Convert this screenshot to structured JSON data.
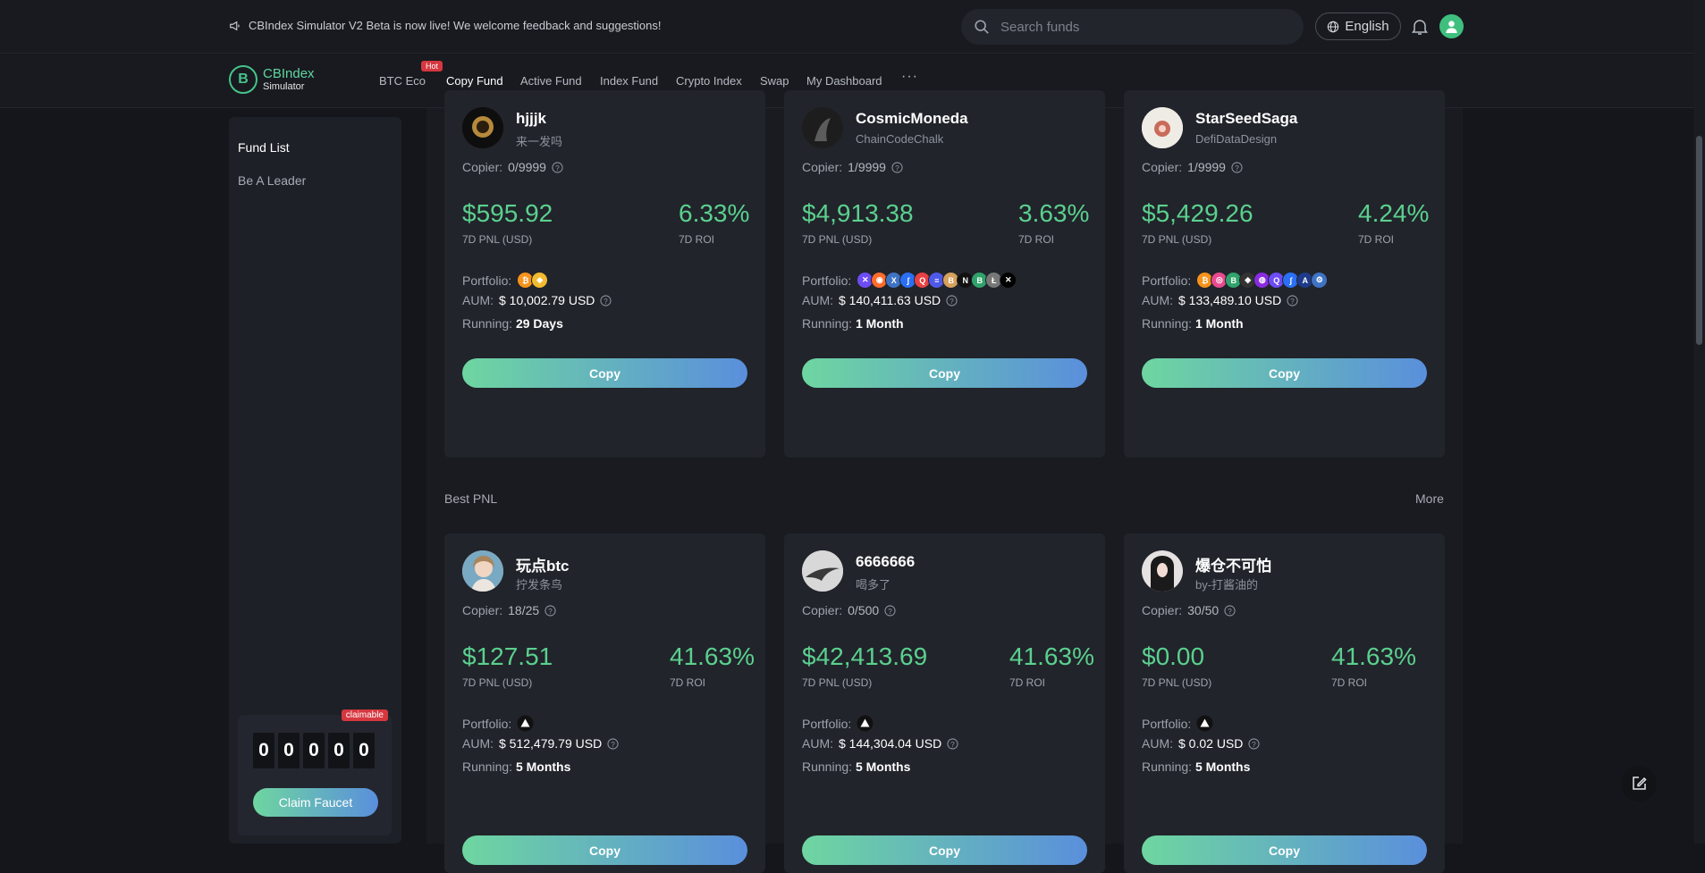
{
  "topbar": {
    "announcement": "CBIndex Simulator V2 Beta is now live! We welcome feedback and suggestions!",
    "search_placeholder": "Search funds",
    "language": "English"
  },
  "nav": {
    "logo_name": "CBIndex",
    "logo_sub": "Simulator",
    "logo_mark": "B",
    "hot_badge": "Hot",
    "items": [
      "BTC Eco",
      "Copy Fund",
      "Active Fund",
      "Index Fund",
      "Crypto Index",
      "Swap",
      "My Dashboard"
    ],
    "active": "Copy Fund",
    "more": "···"
  },
  "sidebar": {
    "items": [
      "Fund List",
      "Be A Leader"
    ],
    "claimable_badge": "claimable",
    "digits": [
      "0",
      "0",
      "0",
      "0",
      "0"
    ],
    "claim_label": "Claim Faucet"
  },
  "labels": {
    "copier": "Copier:",
    "pnl": "7D PNL (USD)",
    "roi": "7D ROI",
    "portfolio": "Portfolio:",
    "aum": "AUM:",
    "running": "Running:",
    "copy": "Copy"
  },
  "top_funds": [
    {
      "name": "hjjjk",
      "sub": "来一发吗",
      "copier": "0/9999",
      "pnl": "$595.92",
      "roi": "6.33%",
      "aum": "$ 10,002.79 USD",
      "running": "29 Days",
      "coins": [
        {
          "c": "#f7931a",
          "t": "₿"
        },
        {
          "c": "#f3ba2f",
          "t": "◆"
        }
      ]
    },
    {
      "name": "CosmicMoneda",
      "sub": "ChainCodeChalk",
      "copier": "1/9999",
      "pnl": "$4,913.38",
      "roi": "3.63%",
      "aum": "$ 140,411.63 USD",
      "running": "1 Month",
      "coins": [
        {
          "c": "#6e4cf5",
          "t": "✕"
        },
        {
          "c": "#ff6b2b",
          "t": "◉"
        },
        {
          "c": "#3e73c4",
          "t": "X"
        },
        {
          "c": "#2a6ff5",
          "t": "∫"
        },
        {
          "c": "#e84142",
          "t": "Q"
        },
        {
          "c": "#4f59e8",
          "t": "≡"
        },
        {
          "c": "#d6a15b",
          "t": "B"
        },
        {
          "c": "#111111",
          "t": "N"
        },
        {
          "c": "#2fa36b",
          "t": "B"
        },
        {
          "c": "#777777",
          "t": "Ł"
        },
        {
          "c": "#000000",
          "t": "✕"
        }
      ]
    },
    {
      "name": "StarSeedSaga",
      "sub": "DefiDataDesign",
      "copier": "1/9999",
      "pnl": "$5,429.26",
      "roi": "4.24%",
      "aum": "$ 133,489.10 USD",
      "running": "1 Month",
      "coins": [
        {
          "c": "#f7931a",
          "t": "₿"
        },
        {
          "c": "#e84a8f",
          "t": "◎"
        },
        {
          "c": "#2fa36b",
          "t": "B"
        },
        {
          "c": "#333333",
          "t": "◆"
        },
        {
          "c": "#8a2be2",
          "t": "◍"
        },
        {
          "c": "#6e4cf5",
          "t": "Q"
        },
        {
          "c": "#2a6ff5",
          "t": "∫"
        },
        {
          "c": "#1e3a8a",
          "t": "A"
        },
        {
          "c": "#3e73c4",
          "t": "⚙"
        }
      ]
    }
  ],
  "best_pnl": {
    "title": "Best PNL",
    "more": "More",
    "funds": [
      {
        "name": "玩点btc",
        "sub": "拧发条鸟",
        "copier": "18/25",
        "pnl": "$127.51",
        "roi": "41.63%",
        "aum": "$ 512,479.79 USD",
        "running": "5 Months"
      },
      {
        "name": "6666666",
        "sub": "喝多了",
        "copier": "0/500",
        "pnl": "$42,413.69",
        "roi": "41.63%",
        "aum": "$ 144,304.04 USD",
        "running": "5 Months"
      },
      {
        "name": "爆仓不可怕",
        "sub": "by-打酱油的",
        "copier": "30/50",
        "pnl": "$0.00",
        "roi": "41.63%",
        "aum": "$ 0.02 USD",
        "running": "5 Months"
      }
    ]
  }
}
